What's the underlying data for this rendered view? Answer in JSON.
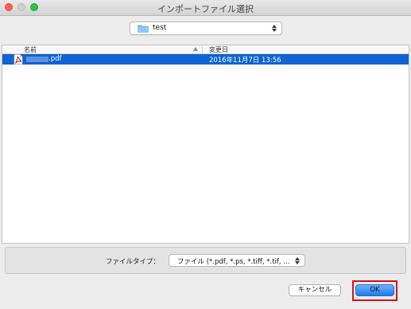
{
  "window": {
    "title": "インポートファイル選択"
  },
  "location": {
    "folder": "test"
  },
  "file_list": {
    "columns": {
      "name": "名前",
      "date_modified": "変更日"
    },
    "rows": [
      {
        "name_visible_suffix": ".pdf",
        "date_modified": "2016年11月7日 13:56",
        "type_icon": "pdf-file-icon",
        "selected": true
      }
    ]
  },
  "file_type": {
    "label": "ファイルタイプ：",
    "selected_value": "ファイル (*.pdf, *.ps, *.tiff, *.tif, ..."
  },
  "buttons": {
    "cancel": "キャンセル",
    "ok": "OK"
  },
  "colors": {
    "selection": "#0d64d2",
    "highlight_outline": "#d8101c",
    "default_button": "#1b7cf0"
  }
}
